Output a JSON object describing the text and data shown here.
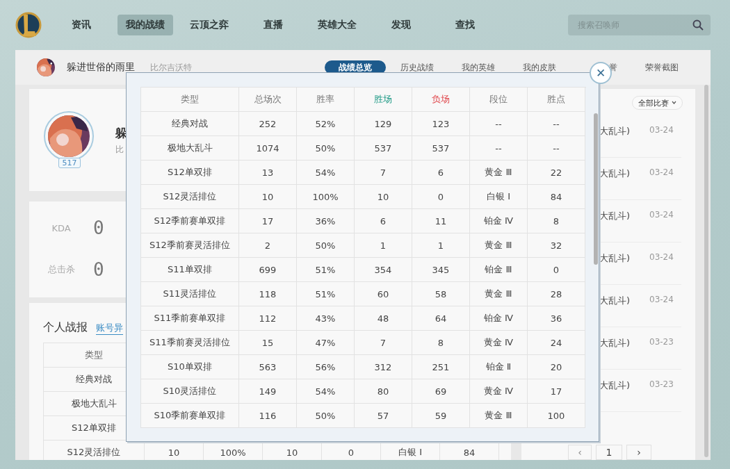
{
  "nav": {
    "items": [
      {
        "label": "资讯",
        "selected": false
      },
      {
        "label": "我的战绩",
        "selected": true
      },
      {
        "label": "云顶之弈",
        "selected": false
      },
      {
        "label": "直播",
        "selected": false
      },
      {
        "label": "英雄大全",
        "selected": false
      },
      {
        "label": "发现",
        "selected": false
      },
      {
        "label": "查找",
        "selected": false
      }
    ],
    "search": {
      "placeholder": "搜索召唤师"
    }
  },
  "header": {
    "name": "躲进世俗的雨里",
    "server": "比尔吉沃特",
    "tabs": [
      {
        "label": "战绩总览",
        "selected": true
      },
      {
        "label": "历史战绩",
        "selected": false
      },
      {
        "label": "我的英雄",
        "selected": false
      },
      {
        "label": "我的皮肤",
        "selected": false
      },
      {
        "label": "誉",
        "selected": false
      },
      {
        "label": "荣誉截图",
        "selected": false
      }
    ]
  },
  "profile": {
    "level": "517",
    "name": "躲",
    "server": "比"
  },
  "stats": [
    {
      "label": "KDA",
      "value": "0"
    },
    {
      "label": "总击杀",
      "value": "0"
    }
  ],
  "report": {
    "title": "个人战报",
    "link": "账号异",
    "columns": [
      "类型"
    ],
    "rows": [
      {
        "cells": [
          "经典对战"
        ]
      },
      {
        "cells": [
          "极地大乱斗"
        ]
      },
      {
        "cells": [
          "S12单双排"
        ]
      },
      {
        "cells": [
          "S12灵活排位",
          "10",
          "100%",
          "10",
          "0",
          "白银 Ⅰ",
          "84"
        ]
      }
    ]
  },
  "matches": {
    "filter": "全部比赛",
    "items": [
      {
        "mode": "大乱斗)",
        "date": "03-24"
      },
      {
        "mode": "大乱斗)",
        "date": "03-24"
      },
      {
        "mode": "大乱斗)",
        "date": "03-24"
      },
      {
        "mode": "大乱斗)",
        "date": "03-24"
      },
      {
        "mode": "大乱斗)",
        "date": "03-24"
      },
      {
        "mode": "大乱斗)",
        "date": "03-23"
      },
      {
        "mode": "大乱斗)",
        "date": "03-23"
      }
    ],
    "pager": {
      "prev": "‹",
      "page": "1",
      "next": "›"
    }
  },
  "modal": {
    "close": "✕",
    "columns": [
      {
        "label": "类型",
        "color": "#777777"
      },
      {
        "label": "总场次",
        "color": "#777777"
      },
      {
        "label": "胜率",
        "color": "#777777"
      },
      {
        "label": "胜场",
        "color": "#1f9a86"
      },
      {
        "label": "负场",
        "color": "#e0474c"
      },
      {
        "label": "段位",
        "color": "#777777"
      },
      {
        "label": "胜点",
        "color": "#777777"
      }
    ],
    "rows": [
      [
        "经典对战",
        "252",
        "52%",
        "129",
        "123",
        "--",
        "--"
      ],
      [
        "极地大乱斗",
        "1074",
        "50%",
        "537",
        "537",
        "--",
        "--"
      ],
      [
        "S12单双排",
        "13",
        "54%",
        "7",
        "6",
        "黄金 Ⅲ",
        "22"
      ],
      [
        "S12灵活排位",
        "10",
        "100%",
        "10",
        "0",
        "白银 Ⅰ",
        "84"
      ],
      [
        "S12季前赛单双排",
        "17",
        "36%",
        "6",
        "11",
        "铂金 Ⅳ",
        "8"
      ],
      [
        "S12季前赛灵活排位",
        "2",
        "50%",
        "1",
        "1",
        "黄金 Ⅲ",
        "32"
      ],
      [
        "S11单双排",
        "699",
        "51%",
        "354",
        "345",
        "铂金 Ⅲ",
        "0"
      ],
      [
        "S11灵活排位",
        "118",
        "51%",
        "60",
        "58",
        "黄金 Ⅲ",
        "28"
      ],
      [
        "S11季前赛单双排",
        "112",
        "43%",
        "48",
        "64",
        "铂金 Ⅳ",
        "36"
      ],
      [
        "S11季前赛灵活排位",
        "15",
        "47%",
        "7",
        "8",
        "黄金 Ⅳ",
        "24"
      ],
      [
        "S10单双排",
        "563",
        "56%",
        "312",
        "251",
        "铂金 Ⅱ",
        "20"
      ],
      [
        "S10灵活排位",
        "149",
        "54%",
        "80",
        "69",
        "黄金 Ⅳ",
        "17"
      ],
      [
        "S10季前赛单双排",
        "116",
        "50%",
        "57",
        "59",
        "黄金 Ⅲ",
        "100"
      ]
    ]
  }
}
